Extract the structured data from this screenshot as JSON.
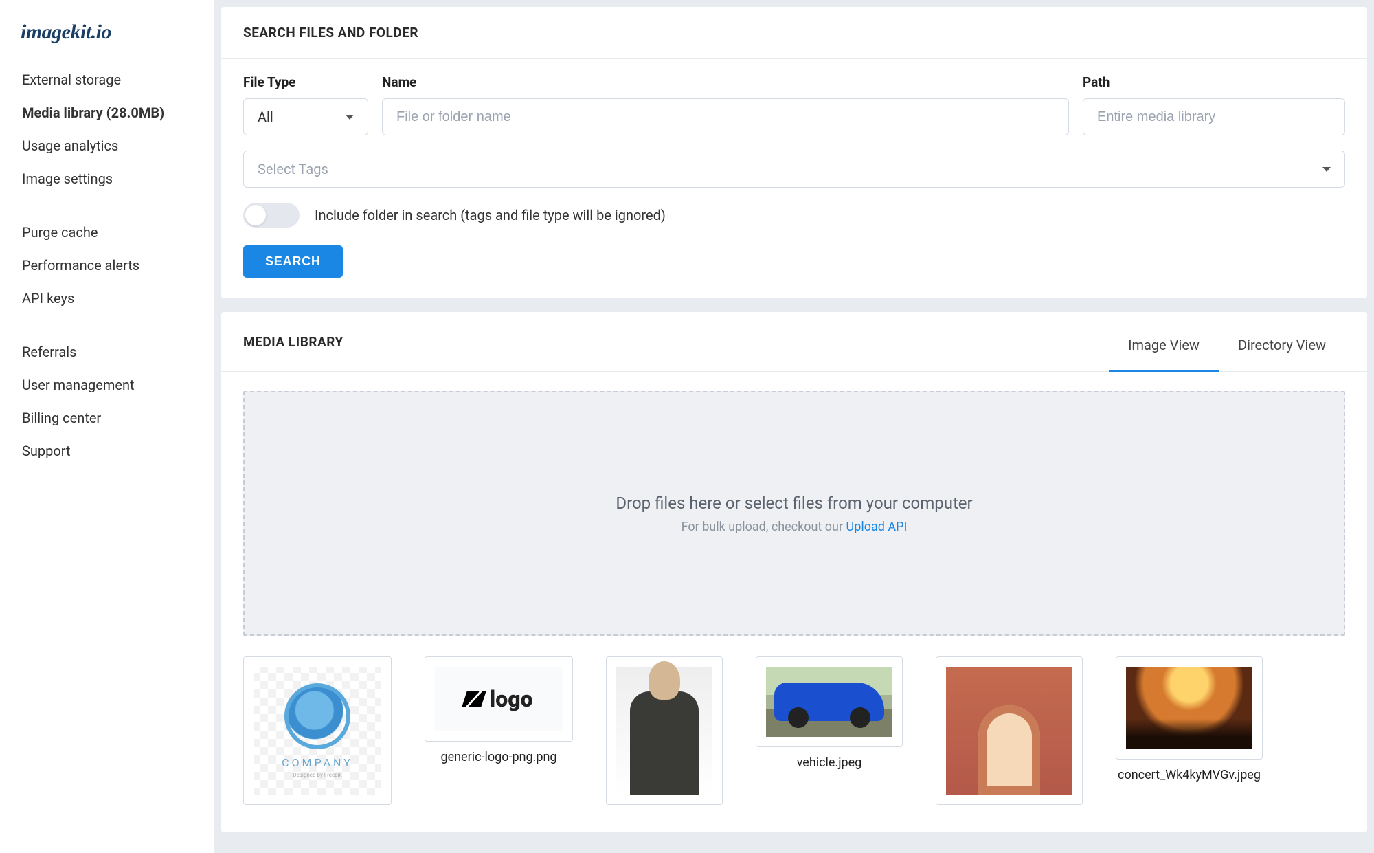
{
  "brand": "imagekit.io",
  "sidebar": {
    "group1": [
      {
        "label": "External storage"
      },
      {
        "label": "Media library (28.0MB)",
        "active": true
      },
      {
        "label": "Usage analytics"
      },
      {
        "label": "Image settings"
      }
    ],
    "group2": [
      {
        "label": "Purge cache"
      },
      {
        "label": "Performance alerts"
      },
      {
        "label": "API keys"
      }
    ],
    "group3": [
      {
        "label": "Referrals"
      },
      {
        "label": "User management"
      },
      {
        "label": "Billing center"
      },
      {
        "label": "Support"
      }
    ]
  },
  "search": {
    "title": "SEARCH FILES AND FOLDER",
    "file_type_label": "File Type",
    "file_type_value": "All",
    "name_label": "Name",
    "name_placeholder": "File or folder name",
    "path_label": "Path",
    "path_placeholder": "Entire media library",
    "tags_placeholder": "Select Tags",
    "include_folder_label": "Include folder in search (tags and file type will be ignored)",
    "button": "SEARCH"
  },
  "library": {
    "title": "MEDIA LIBRARY",
    "tabs": {
      "image": "Image View",
      "directory": "Directory View"
    },
    "drop_main": "Drop files here or select files from your computer",
    "drop_sub_prefix": "For bulk upload, checkout our ",
    "drop_link": "Upload API",
    "files": [
      {
        "name": ""
      },
      {
        "name": "generic-logo-png.png"
      },
      {
        "name": ""
      },
      {
        "name": "vehicle.jpeg"
      },
      {
        "name": ""
      },
      {
        "name": "concert_Wk4kyMVGv.jpeg"
      }
    ]
  }
}
